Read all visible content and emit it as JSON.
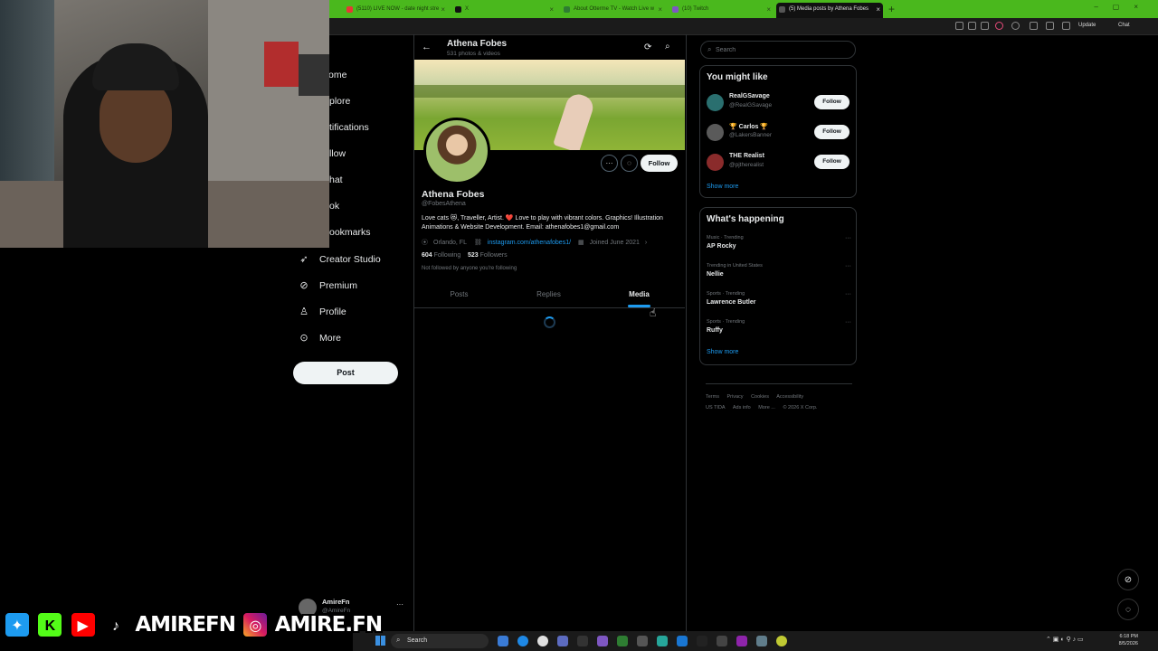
{
  "browser": {
    "tabs": [
      {
        "label": "(5110) LIVE NOW - date night stre",
        "color": "#e53935"
      },
      {
        "label": "X",
        "color": "#111111"
      },
      {
        "label": "About Otterme TV - Watch Live w",
        "color": "#2e7d32"
      },
      {
        "label": "(10) Twitch",
        "color": "#7e57c2"
      },
      {
        "label": "(5) Media posts by Athena Fobes",
        "color": "#111111",
        "active": true
      }
    ],
    "update_label": "Update",
    "chat_label": "Chat"
  },
  "nav": {
    "items": [
      {
        "label": "ome",
        "icon": "home-icon"
      },
      {
        "label": "plore",
        "icon": "explore-icon"
      },
      {
        "label": "tifications",
        "icon": "bell-icon"
      },
      {
        "label": "llow",
        "icon": "follow-icon"
      },
      {
        "label": "hat",
        "icon": "chat-icon"
      },
      {
        "label": "ok",
        "icon": "grok-icon"
      },
      {
        "label": "ookmarks",
        "icon": "bookmark-icon"
      },
      {
        "label": "Creator Studio",
        "icon": "rocket-icon"
      },
      {
        "label": "Premium",
        "icon": "premium-icon"
      },
      {
        "label": "Profile",
        "icon": "person-icon"
      },
      {
        "label": "More",
        "icon": "more-circle-icon"
      }
    ],
    "post_label": "Post",
    "account_name": "AmireFn",
    "account_handle": "@AmireFn"
  },
  "profile": {
    "header_name": "Athena Fobes",
    "header_count": "531 photos & videos",
    "name": "Athena Fobes",
    "handle": "@FobesAthena",
    "bio": "Love cats 😻, Traveller, Artist. ❤️ Love to play with vibrant colors. Graphics! Illustration Animations & Website Development. Email: athenafobes1@gmail.com",
    "location": "Orlando, FL",
    "website": "instagram.com/athenafobes1/",
    "joined": "Joined June 2021",
    "following_count": "604",
    "following_label": "Following",
    "followers_count": "523",
    "followers_label": "Followers",
    "not_followed": "Not followed by anyone you're following",
    "follow_label": "Follow",
    "tabs": [
      "Posts",
      "Replies",
      "Media"
    ],
    "active_tab": "Media"
  },
  "right": {
    "search_placeholder": "Search",
    "wtf_title": "You might like",
    "who_to_follow": [
      {
        "name": "RealGSavage",
        "handle": "@RealGSavage",
        "avatar_color": "#2a6f6f"
      },
      {
        "name": "🏆 Carlos 🏆",
        "handle": "@LakersBanner",
        "avatar_color": "#5a5a5a"
      },
      {
        "name": "THE Realist",
        "handle": "@pjtherealist",
        "avatar_color": "#8a2b2b"
      }
    ],
    "follow_label": "Follow",
    "show_more": "Show more",
    "trends_title": "What's happening",
    "trends": [
      {
        "context": "Music · Trending",
        "title": "AP Rocky"
      },
      {
        "context": "Trending in United States",
        "title": "Nellie"
      },
      {
        "context": "Sports · Trending",
        "title": "Lawrence Butler"
      },
      {
        "context": "Sports · Trending",
        "title": "Ruffy"
      }
    ],
    "footer_links": [
      "Terms",
      "Privacy",
      "Cookies",
      "Accessibility",
      "US TIDA",
      "Ads info",
      "More ...",
      "© 2026 X Corp."
    ]
  },
  "overlay": {
    "handle1": "AMIREFN",
    "handle2": "AMIRE.FN"
  },
  "taskbar": {
    "search_label": "Search",
    "time": "6:18 PM",
    "date": "8/5/2026"
  }
}
